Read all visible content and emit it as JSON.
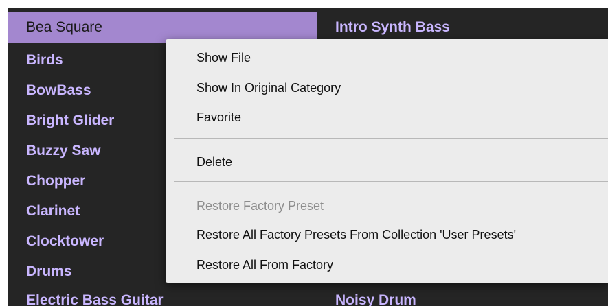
{
  "presets": {
    "selected": "Bea Square",
    "items": [
      "Birds",
      "BowBass",
      "Bright Glider",
      "Buzzy Saw",
      "Chopper",
      "Clarinet",
      "Clocktower",
      "Drums",
      "Electric Bass Guitar"
    ]
  },
  "column2": {
    "top_item": "Intro Synth Bass",
    "bottom_item": "Noisy Drum"
  },
  "context_menu": {
    "show_file": "Show File",
    "show_in_original_category": "Show In Original Category",
    "favorite": "Favorite",
    "delete": "Delete",
    "restore_factory_preset": "Restore Factory Preset",
    "restore_all_from_collection": "Restore All Factory Presets From Collection 'User Presets'",
    "restore_all_from_factory": "Restore All From Factory"
  },
  "colors": {
    "selection": "#a387cf",
    "item_text": "#c9b6ff",
    "background": "#252525",
    "menu_background": "#ececec",
    "menu_disabled_text": "#8d8d8d"
  }
}
